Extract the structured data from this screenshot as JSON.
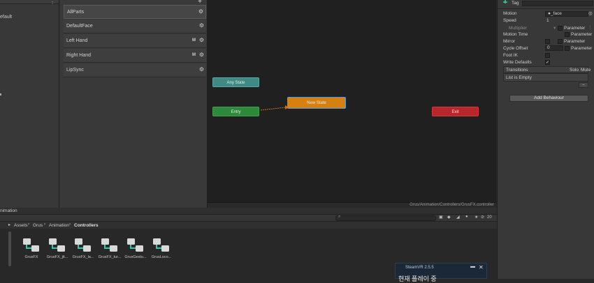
{
  "hierarchy": {
    "items": [
      "efault",
      "nimation"
    ],
    "kebab": "⋮"
  },
  "layers": {
    "add_label": "+",
    "items": [
      {
        "name": "AllParts",
        "m": "",
        "selected": true
      },
      {
        "name": "DefaultFace",
        "m": ""
      },
      {
        "name": "Left Hand",
        "m": "M"
      },
      {
        "name": "Right Hand",
        "m": "M"
      },
      {
        "name": "LipSync",
        "m": ""
      }
    ],
    "gear_glyph": "⚙"
  },
  "graph": {
    "nodes": {
      "any_state": "Any State",
      "entry": "Entry",
      "new_state": "New State",
      "exit": "Exit"
    },
    "path": "Grus/Animation/Controllers/GrusFX.controller"
  },
  "inspector": {
    "tag_label": "Tag",
    "motion_label": "Motion",
    "motion_value": "●_face",
    "speed_label": "Speed",
    "speed_value": "1",
    "multiplier_label": "Multiplier",
    "parameter_label": "Parameter",
    "motion_time_label": "Motion Time",
    "mirror_label": "Mirror",
    "cycle_offset_label": "Cycle Offset",
    "cycle_offset_value": "0",
    "foot_ik_label": "Foot IK",
    "write_defaults_label": "Write Defaults",
    "transitions_label": "Transitions",
    "solo_label": "Solo",
    "mute_label": "Mute",
    "list_empty": "List is Empty",
    "minus_label": "–",
    "add_behaviour": "Add Behaviour"
  },
  "project": {
    "breadcrumb": [
      "Assets",
      "Grus",
      "Animation",
      "Controllers"
    ],
    "search_count": "20",
    "assets": [
      "GrusFX",
      "GrusFX_jit...",
      "GrusFX_la...",
      "GrusFX_tur...",
      "GrusGestu...",
      "GrusLoco..."
    ]
  },
  "steamvr": {
    "title": "SteamVR 2.5.5",
    "subtitle": "현재 플레이 중"
  },
  "colors": {
    "any_state": "#3e8a84",
    "entry": "#2c8a3a",
    "new_state": "#d7800f",
    "exit": "#b8262a"
  }
}
